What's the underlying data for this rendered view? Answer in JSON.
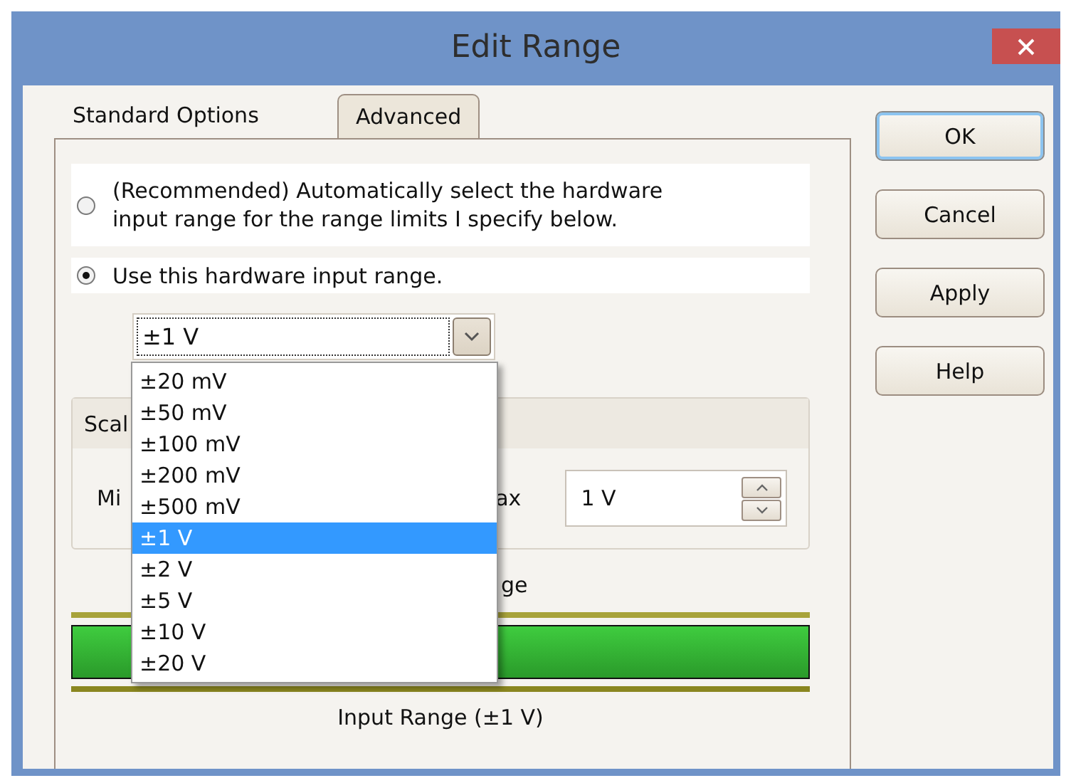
{
  "window": {
    "title": "Edit Range"
  },
  "tabs": [
    {
      "label": "Standard Options",
      "selected": true
    },
    {
      "label": "Advanced",
      "selected": false
    }
  ],
  "range_mode": [
    {
      "label": "(Recommended) Automatically select the hardware input range for the range limits I specify below.",
      "selected": false
    },
    {
      "label": "Use this hardware input range.",
      "selected": true
    }
  ],
  "range_combo": {
    "value": "±1 V",
    "expanded": true,
    "options": [
      {
        "label": "±20 mV",
        "selected": false
      },
      {
        "label": "±50 mV",
        "selected": false
      },
      {
        "label": "±100 mV",
        "selected": false
      },
      {
        "label": "±200 mV",
        "selected": false
      },
      {
        "label": "±500 mV",
        "selected": false
      },
      {
        "label": "±1 V",
        "selected": true
      },
      {
        "label": "±2 V",
        "selected": false
      },
      {
        "label": "±5 V",
        "selected": false
      },
      {
        "label": "±10 V",
        "selected": false
      },
      {
        "label": "±20 V",
        "selected": false
      }
    ]
  },
  "scaling_group": {
    "title": "Scal",
    "min_label": "Mi",
    "max_label": "ax",
    "max_value": "1 V"
  },
  "range_display": {
    "title": "ge",
    "caption": "Input Range (±1 V)"
  },
  "buttons": [
    {
      "label": "OK",
      "default": true
    },
    {
      "label": "Cancel",
      "default": false
    },
    {
      "label": "Apply",
      "default": false
    },
    {
      "label": "Help",
      "default": false
    }
  ]
}
